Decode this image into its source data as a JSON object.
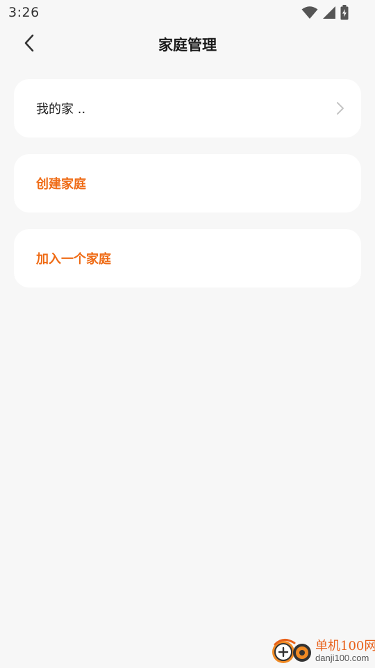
{
  "status_bar": {
    "time": "3:26",
    "icons": [
      "wifi-icon",
      "cellular-signal-icon",
      "battery-charging-icon"
    ]
  },
  "header": {
    "title": "家庭管理",
    "back_icon": "chevron-left-icon"
  },
  "home_list": {
    "items": [
      {
        "label": "我的家 ..",
        "icon": "chevron-right-icon"
      }
    ]
  },
  "actions": {
    "create_family": "创建家庭",
    "join_family": "加入一个家庭"
  },
  "watermark": {
    "title": "单机100网",
    "url": "danji100.com"
  },
  "colors": {
    "background": "#f7f7f7",
    "card": "#ffffff",
    "accent": "#ef6b15",
    "text": "#222222"
  }
}
